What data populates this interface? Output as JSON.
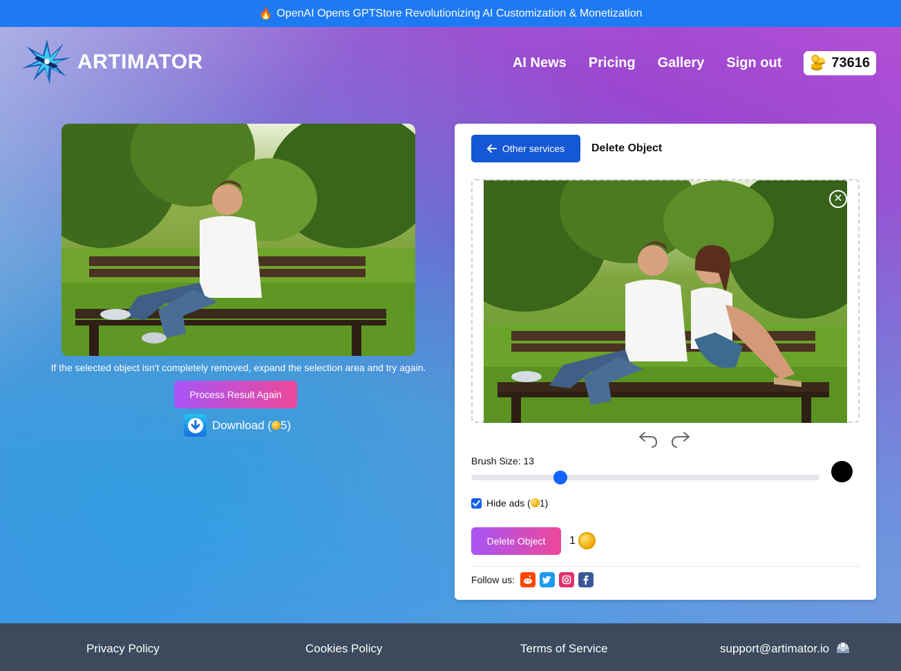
{
  "announcement": {
    "icon": "fire-icon",
    "text": "OpenAI Opens GPTStore Revolutionizing AI Customization & Monetization"
  },
  "header": {
    "logo_text": "ARTIMATOR",
    "nav": [
      "AI News",
      "Pricing",
      "Gallery",
      "Sign out"
    ],
    "coin_balance": "73616"
  },
  "result": {
    "hint": "If the selected object isn't completely removed, expand the selection area and try again.",
    "process_label": "Process Result Again",
    "download_prefix": "Download (",
    "download_cost": "5",
    "download_suffix": ")"
  },
  "editor": {
    "back_label": "Other services",
    "title": "Delete Object",
    "brush_label": "Brush Size: 13",
    "brush_size": 13,
    "hide_ads_prefix": "Hide ads (",
    "hide_ads_cost": "1",
    "hide_ads_suffix": ")",
    "hide_ads_checked": true,
    "delete_label": "Delete Object",
    "cost": "1",
    "follow_label": "Follow us:",
    "social": [
      "reddit-icon",
      "twitter-icon",
      "instagram-icon",
      "facebook-icon"
    ]
  },
  "footer": {
    "links": [
      "Privacy Policy",
      "Cookies Policy",
      "Terms of Service",
      "support@artimator.io"
    ],
    "email_icon": "inbox-tray-icon"
  },
  "colors": {
    "accent_blue": "#1558d6",
    "gradient_start": "#a855f7",
    "gradient_end": "#ec4899",
    "footer_bg": "#3c4a5c"
  }
}
